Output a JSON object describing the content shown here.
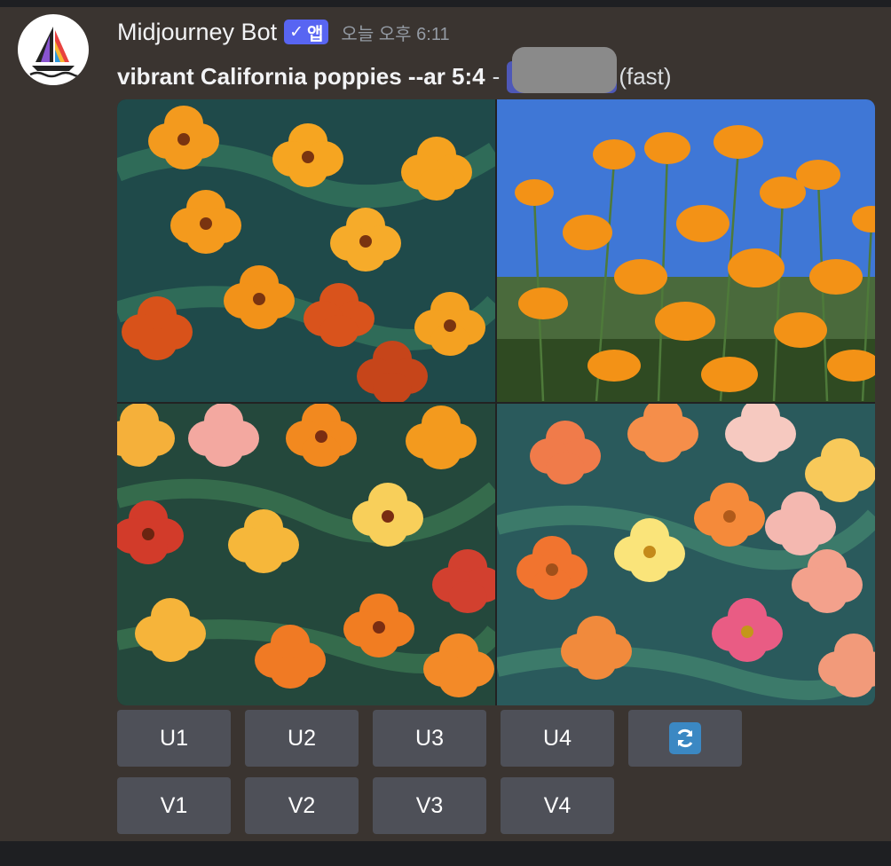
{
  "message": {
    "author": "Midjourney Bot",
    "app_badge": {
      "check": "✓",
      "label": "앱"
    },
    "timestamp": "오늘 오후 6:11",
    "prompt": "vibrant California poppies --ar 5:4",
    "separator": "-",
    "speed": "(fast)"
  },
  "image_grid": {
    "tiles": [
      {
        "label": "Image 1"
      },
      {
        "label": "Image 2"
      },
      {
        "label": "Image 3"
      },
      {
        "label": "Image 4"
      }
    ]
  },
  "buttons": {
    "upscale": [
      "U1",
      "U2",
      "U3",
      "U4"
    ],
    "variation": [
      "V1",
      "V2",
      "V3",
      "V4"
    ],
    "reroll_icon": "refresh-icon"
  },
  "colors": {
    "background": "#3a3430",
    "button": "#4e5058",
    "badge": "#5865f2",
    "reroll": "#3b88c3"
  }
}
